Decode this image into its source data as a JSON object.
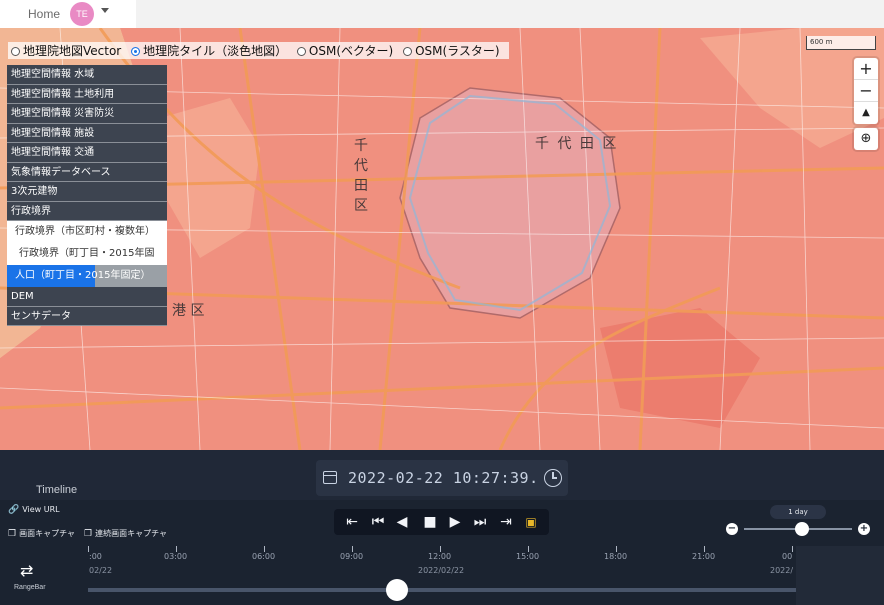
{
  "topbar": {
    "home_label": "Home",
    "avatar_initials": "TE"
  },
  "map": {
    "base_layers": [
      {
        "label": "地理院地図Vector",
        "selected": false
      },
      {
        "label": "地理院タイル（淡色地図）",
        "selected": true
      },
      {
        "label": "OSM(ベクター)",
        "selected": false
      },
      {
        "label": "OSM(ラスター)",
        "selected": false
      }
    ],
    "scale_label": "600 m",
    "labels": {
      "chiyoda_h": "千 代 田 区",
      "chiyoda_v": [
        "千",
        "代",
        "田",
        "区"
      ],
      "minato": "港 区"
    },
    "colors": {
      "choropleth": "#f08b7c",
      "base": "#f3cfa3",
      "road": "#f29b57"
    }
  },
  "layer_menu": {
    "items": [
      "地理空間情報 水域",
      "地理空間情報 土地利用",
      "地理空間情報 災害防災",
      "地理空間情報 施設",
      "地理空間情報 交通",
      "気象情報データベース",
      "3次元建物",
      "行政境界"
    ],
    "subitems": [
      {
        "label": "行政境界（市区町村・複数年）",
        "selected": false
      },
      {
        "label": "行政境界（町丁目・2015年固",
        "selected": false
      },
      {
        "label": "人口（町丁目・2015年固定）",
        "selected": true
      }
    ],
    "items_after": [
      "DEM",
      "センサデータ"
    ]
  },
  "timeline": {
    "label": "Timeline",
    "datetime": "2022-02-22 10:27:39.",
    "view_url": "View URL",
    "capture": "画面キャプチャ",
    "continuous_capture": "連続画面キャプチャ",
    "speed_label": "1 day",
    "speed_level": 0.5,
    "rangebar_label": "RangeBar",
    "ticks": [
      ":00",
      "03:00",
      "06:00",
      "09:00",
      "12:00",
      "15:00",
      "18:00",
      "21:00",
      "00"
    ],
    "dates": [
      "02/22",
      "2022/02/22",
      "2022/"
    ],
    "range_position": 0.435,
    "colors": {
      "accent": "#e8b72a",
      "panel": "#1b2330"
    }
  }
}
